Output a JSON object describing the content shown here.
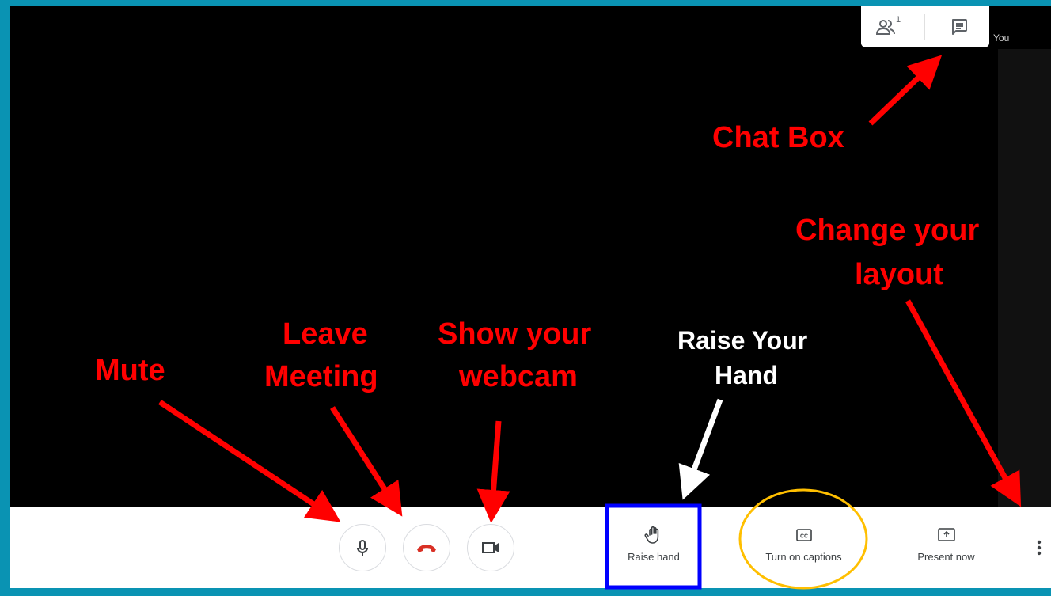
{
  "top_panel": {
    "participants_icon": "people-icon",
    "participant_count": "1",
    "chat_icon": "chat-icon",
    "self_label": "You"
  },
  "controls": {
    "mic_icon": "microphone-icon",
    "hangup_icon": "phone-hangup-icon",
    "camera_icon": "videocam-icon",
    "raise_hand": "Raise hand",
    "captions": "Turn on captions",
    "present": "Present now",
    "more_icon": "more-vert-icon"
  },
  "annotations": {
    "chat_box": "Chat Box",
    "change_layout_1": "Change your",
    "change_layout_2": "layout",
    "mute": "Mute",
    "leave_1": "Leave",
    "leave_2": "Meeting",
    "webcam_1": "Show your",
    "webcam_2": "webcam",
    "raise_1": "Raise Your",
    "raise_2": "Hand"
  },
  "colors": {
    "frame": "#0a93b3",
    "annotation": "#ff0000",
    "highlight_blue": "#0000ff",
    "highlight_yellow": "#ffbf00",
    "hangup": "#d93025"
  }
}
